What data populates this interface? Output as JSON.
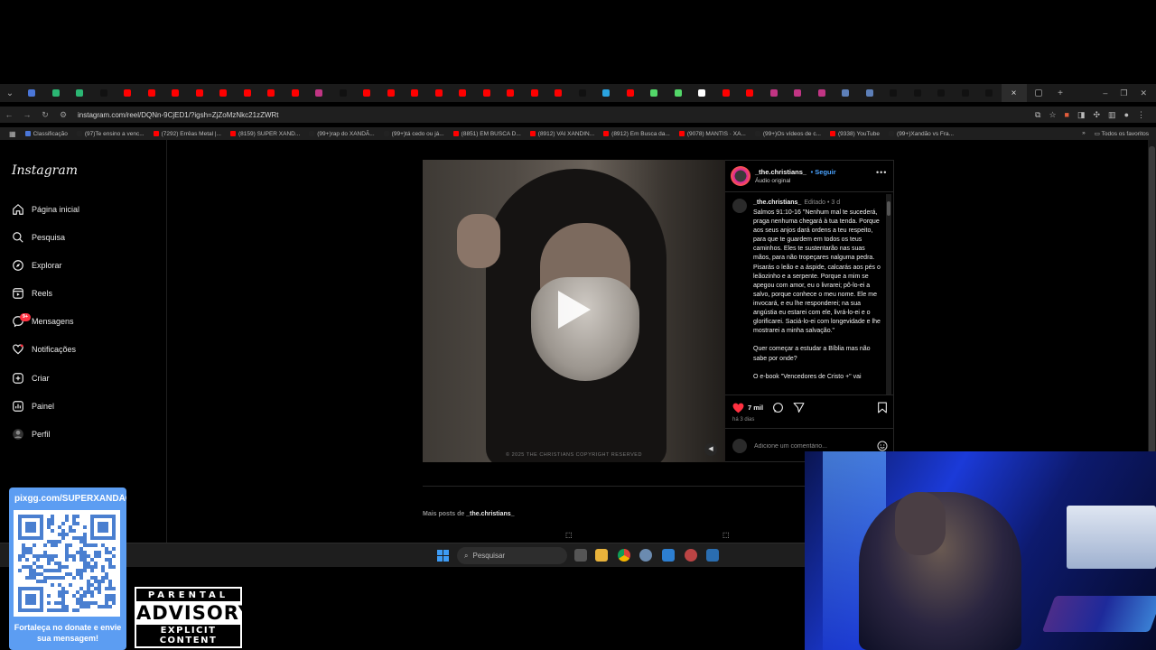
{
  "browser": {
    "tab_count": 43,
    "active_tab_close": "×",
    "new_tab": "+",
    "url": "instagram.com/reel/DQNn-9CjED1/?igsh=ZjZoMzNkc21zZWRt",
    "bookmarks": [
      {
        "label": "Classificação",
        "color": "#4a76d8"
      },
      {
        "label": "(97)Te ensino a venc...",
        "color": "#222222"
      },
      {
        "label": "(7292) Errêas Metal |...",
        "color": "#ff0000"
      },
      {
        "label": "(8159) SUPER XAND...",
        "color": "#ff0000"
      },
      {
        "label": "(99+)rap do XANDÃ...",
        "color": "#222222"
      },
      {
        "label": "(99+)tá cedo ou já...",
        "color": "#222222"
      },
      {
        "label": "(8851) EM BUSCA D...",
        "color": "#ff0000"
      },
      {
        "label": "(8912) VAI XANDIN...",
        "color": "#ff0000"
      },
      {
        "label": "(8912) Em Busca da...",
        "color": "#ff0000"
      },
      {
        "label": "(9078) MANTIS · XA...",
        "color": "#ff0000"
      },
      {
        "label": "(99+)Os vídeos de c...",
        "color": "#222222"
      },
      {
        "label": "(9338) YouTube",
        "color": "#ff0000"
      },
      {
        "label": "(99+)Xandão vs Fra...",
        "color": "#222222"
      }
    ],
    "all_favorites": "Todos os favoritos"
  },
  "instagram": {
    "logo": "Instagram",
    "nav": [
      {
        "label": "Página inicial",
        "icon": "home-icon"
      },
      {
        "label": "Pesquisa",
        "icon": "search-icon"
      },
      {
        "label": "Explorar",
        "icon": "compass-icon"
      },
      {
        "label": "Reels",
        "icon": "reels-icon"
      },
      {
        "label": "Mensagens",
        "icon": "messenger-icon"
      },
      {
        "label": "Notificações",
        "icon": "heart-icon"
      },
      {
        "label": "Criar",
        "icon": "plus-square-icon"
      },
      {
        "label": "Painel",
        "icon": "dashboard-icon"
      },
      {
        "label": "Perfil",
        "icon": "profile-icon"
      }
    ],
    "messages_badge": "9+",
    "post": {
      "username": "_the.christians_",
      "follow": "• Seguir",
      "audio": "Áudio original",
      "more": "•••",
      "caption_user": "_the.christians_",
      "caption_meta": "Editado • 3 d",
      "caption": "Salmos 91:10-16 \"Nenhum mal te sucederá, praga nenhuma chegará à tua tenda. Porque aos seus anjos dará ordens a teu respeito, para que te guardem em todos os teus caminhos. Eles te sustentarão nas suas mãos, para não tropeçares nalguma pedra. Pisarás o leão e a áspide, calcarás aos pés o leãozinho e a serpente. Porque a mim se apegou com amor, eu o livrarei; pô-lo-ei a salvo, porque conhece o meu nome. Ele me invocará, e eu lhe responderei; na sua angústia eu estarei com ele, livrá-lo-ei e o glorificarei. Saciá-lo-ei com longevidade e lhe mostrarei a minha salvação.\"\n\nQuer começar a estudar a Bíblia mas não sabe por onde?\n\nO e-book \"Vencedores de Cristo +\" vai",
      "likes": "7 mil",
      "posted_ago": "há 3 dias",
      "comment_placeholder": "Adicione um comentário...",
      "video_copyright": "© 2025 THE CHRISTIANS COPYRIGHT RESERVED"
    },
    "more_posts_prefix": "Mais posts de ",
    "more_posts_user": "_the.christians_"
  },
  "taskbar": {
    "search_placeholder": "Pesquisar"
  },
  "overlay": {
    "pix_url": "pixgg.com/SUPERXANDÃO",
    "donate_note": "Fortaleça no donate e envie sua mensagem!",
    "advisory_top": "PARENTAL",
    "advisory_mid": "ADVISORY",
    "advisory_bottom": "EXPLICIT CONTENT"
  },
  "colors": {
    "like_red": "#ff3040",
    "follow_blue": "#4aa3ff",
    "pix_blue": "#5c9df2"
  }
}
